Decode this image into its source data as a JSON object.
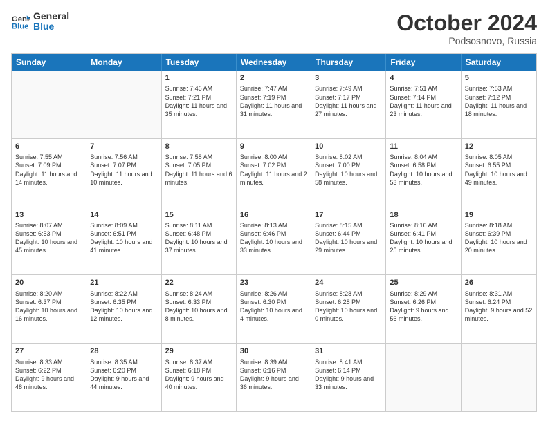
{
  "header": {
    "logo_general": "General",
    "logo_blue": "Blue",
    "month": "October 2024",
    "location": "Podsosnovo, Russia"
  },
  "days_of_week": [
    "Sunday",
    "Monday",
    "Tuesday",
    "Wednesday",
    "Thursday",
    "Friday",
    "Saturday"
  ],
  "weeks": [
    [
      {
        "day": "",
        "sunrise": "",
        "sunset": "",
        "daylight": ""
      },
      {
        "day": "",
        "sunrise": "",
        "sunset": "",
        "daylight": ""
      },
      {
        "day": "1",
        "sunrise": "Sunrise: 7:46 AM",
        "sunset": "Sunset: 7:21 PM",
        "daylight": "Daylight: 11 hours and 35 minutes."
      },
      {
        "day": "2",
        "sunrise": "Sunrise: 7:47 AM",
        "sunset": "Sunset: 7:19 PM",
        "daylight": "Daylight: 11 hours and 31 minutes."
      },
      {
        "day": "3",
        "sunrise": "Sunrise: 7:49 AM",
        "sunset": "Sunset: 7:17 PM",
        "daylight": "Daylight: 11 hours and 27 minutes."
      },
      {
        "day": "4",
        "sunrise": "Sunrise: 7:51 AM",
        "sunset": "Sunset: 7:14 PM",
        "daylight": "Daylight: 11 hours and 23 minutes."
      },
      {
        "day": "5",
        "sunrise": "Sunrise: 7:53 AM",
        "sunset": "Sunset: 7:12 PM",
        "daylight": "Daylight: 11 hours and 18 minutes."
      }
    ],
    [
      {
        "day": "6",
        "sunrise": "Sunrise: 7:55 AM",
        "sunset": "Sunset: 7:09 PM",
        "daylight": "Daylight: 11 hours and 14 minutes."
      },
      {
        "day": "7",
        "sunrise": "Sunrise: 7:56 AM",
        "sunset": "Sunset: 7:07 PM",
        "daylight": "Daylight: 11 hours and 10 minutes."
      },
      {
        "day": "8",
        "sunrise": "Sunrise: 7:58 AM",
        "sunset": "Sunset: 7:05 PM",
        "daylight": "Daylight: 11 hours and 6 minutes."
      },
      {
        "day": "9",
        "sunrise": "Sunrise: 8:00 AM",
        "sunset": "Sunset: 7:02 PM",
        "daylight": "Daylight: 11 hours and 2 minutes."
      },
      {
        "day": "10",
        "sunrise": "Sunrise: 8:02 AM",
        "sunset": "Sunset: 7:00 PM",
        "daylight": "Daylight: 10 hours and 58 minutes."
      },
      {
        "day": "11",
        "sunrise": "Sunrise: 8:04 AM",
        "sunset": "Sunset: 6:58 PM",
        "daylight": "Daylight: 10 hours and 53 minutes."
      },
      {
        "day": "12",
        "sunrise": "Sunrise: 8:05 AM",
        "sunset": "Sunset: 6:55 PM",
        "daylight": "Daylight: 10 hours and 49 minutes."
      }
    ],
    [
      {
        "day": "13",
        "sunrise": "Sunrise: 8:07 AM",
        "sunset": "Sunset: 6:53 PM",
        "daylight": "Daylight: 10 hours and 45 minutes."
      },
      {
        "day": "14",
        "sunrise": "Sunrise: 8:09 AM",
        "sunset": "Sunset: 6:51 PM",
        "daylight": "Daylight: 10 hours and 41 minutes."
      },
      {
        "day": "15",
        "sunrise": "Sunrise: 8:11 AM",
        "sunset": "Sunset: 6:48 PM",
        "daylight": "Daylight: 10 hours and 37 minutes."
      },
      {
        "day": "16",
        "sunrise": "Sunrise: 8:13 AM",
        "sunset": "Sunset: 6:46 PM",
        "daylight": "Daylight: 10 hours and 33 minutes."
      },
      {
        "day": "17",
        "sunrise": "Sunrise: 8:15 AM",
        "sunset": "Sunset: 6:44 PM",
        "daylight": "Daylight: 10 hours and 29 minutes."
      },
      {
        "day": "18",
        "sunrise": "Sunrise: 8:16 AM",
        "sunset": "Sunset: 6:41 PM",
        "daylight": "Daylight: 10 hours and 25 minutes."
      },
      {
        "day": "19",
        "sunrise": "Sunrise: 8:18 AM",
        "sunset": "Sunset: 6:39 PM",
        "daylight": "Daylight: 10 hours and 20 minutes."
      }
    ],
    [
      {
        "day": "20",
        "sunrise": "Sunrise: 8:20 AM",
        "sunset": "Sunset: 6:37 PM",
        "daylight": "Daylight: 10 hours and 16 minutes."
      },
      {
        "day": "21",
        "sunrise": "Sunrise: 8:22 AM",
        "sunset": "Sunset: 6:35 PM",
        "daylight": "Daylight: 10 hours and 12 minutes."
      },
      {
        "day": "22",
        "sunrise": "Sunrise: 8:24 AM",
        "sunset": "Sunset: 6:33 PM",
        "daylight": "Daylight: 10 hours and 8 minutes."
      },
      {
        "day": "23",
        "sunrise": "Sunrise: 8:26 AM",
        "sunset": "Sunset: 6:30 PM",
        "daylight": "Daylight: 10 hours and 4 minutes."
      },
      {
        "day": "24",
        "sunrise": "Sunrise: 8:28 AM",
        "sunset": "Sunset: 6:28 PM",
        "daylight": "Daylight: 10 hours and 0 minutes."
      },
      {
        "day": "25",
        "sunrise": "Sunrise: 8:29 AM",
        "sunset": "Sunset: 6:26 PM",
        "daylight": "Daylight: 9 hours and 56 minutes."
      },
      {
        "day": "26",
        "sunrise": "Sunrise: 8:31 AM",
        "sunset": "Sunset: 6:24 PM",
        "daylight": "Daylight: 9 hours and 52 minutes."
      }
    ],
    [
      {
        "day": "27",
        "sunrise": "Sunrise: 8:33 AM",
        "sunset": "Sunset: 6:22 PM",
        "daylight": "Daylight: 9 hours and 48 minutes."
      },
      {
        "day": "28",
        "sunrise": "Sunrise: 8:35 AM",
        "sunset": "Sunset: 6:20 PM",
        "daylight": "Daylight: 9 hours and 44 minutes."
      },
      {
        "day": "29",
        "sunrise": "Sunrise: 8:37 AM",
        "sunset": "Sunset: 6:18 PM",
        "daylight": "Daylight: 9 hours and 40 minutes."
      },
      {
        "day": "30",
        "sunrise": "Sunrise: 8:39 AM",
        "sunset": "Sunset: 6:16 PM",
        "daylight": "Daylight: 9 hours and 36 minutes."
      },
      {
        "day": "31",
        "sunrise": "Sunrise: 8:41 AM",
        "sunset": "Sunset: 6:14 PM",
        "daylight": "Daylight: 9 hours and 33 minutes."
      },
      {
        "day": "",
        "sunrise": "",
        "sunset": "",
        "daylight": ""
      },
      {
        "day": "",
        "sunrise": "",
        "sunset": "",
        "daylight": ""
      }
    ]
  ]
}
